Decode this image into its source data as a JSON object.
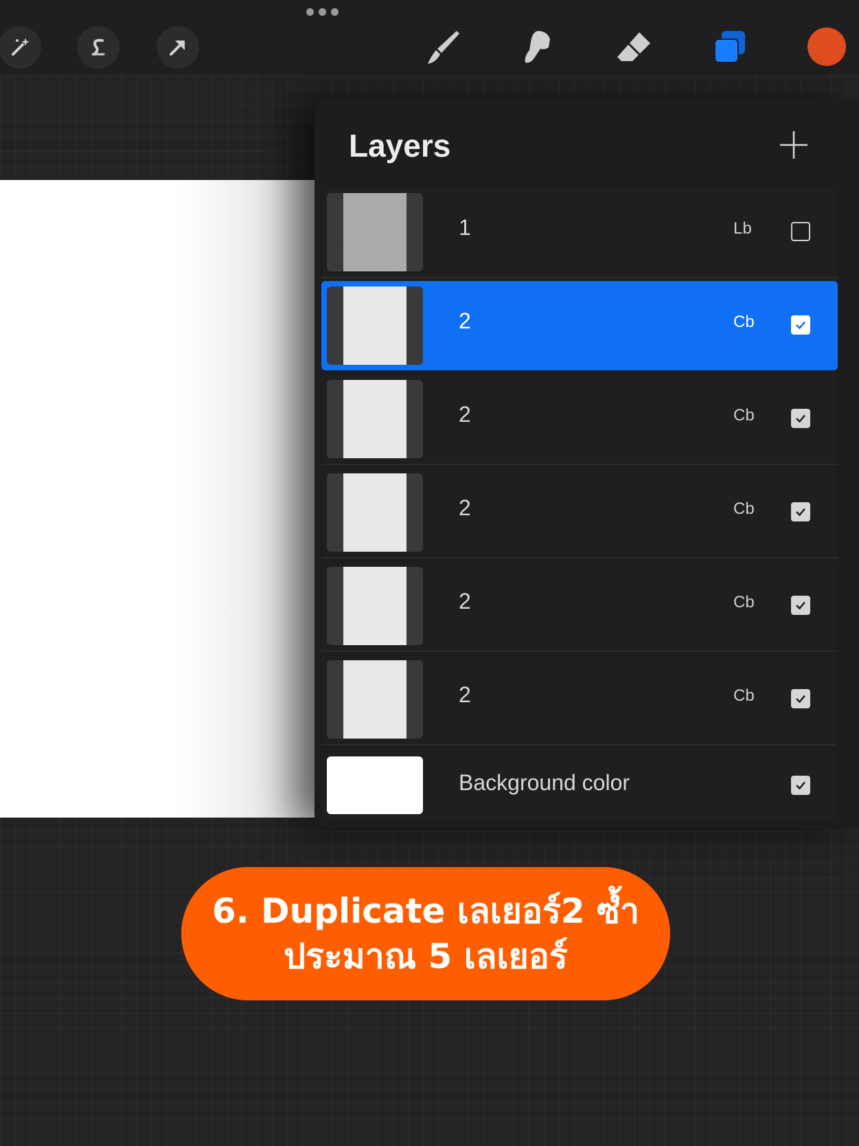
{
  "toolbar": {
    "left_tools": [
      "magic-wand-icon",
      "selection-icon",
      "move-arrow-icon"
    ],
    "right_tools": [
      "brush-icon",
      "smudge-icon",
      "eraser-icon",
      "layers-icon"
    ],
    "current_color": "#e04d1f",
    "accent": "#0f6ff5"
  },
  "layers_panel": {
    "title": "Layers",
    "layers": [
      {
        "name": "1",
        "blend": "Lb",
        "visible": false,
        "selected": false
      },
      {
        "name": "2",
        "blend": "Cb",
        "visible": true,
        "selected": true
      },
      {
        "name": "2",
        "blend": "Cb",
        "visible": true,
        "selected": false
      },
      {
        "name": "2",
        "blend": "Cb",
        "visible": true,
        "selected": false
      },
      {
        "name": "2",
        "blend": "Cb",
        "visible": true,
        "selected": false
      },
      {
        "name": "2",
        "blend": "Cb",
        "visible": true,
        "selected": false
      }
    ],
    "background": {
      "name": "Background color",
      "visible": true
    }
  },
  "callout": {
    "line1": "6. Duplicate เลเยอร์2 ซ้ำ",
    "line2": "ประมาณ 5 เลเยอร์"
  }
}
